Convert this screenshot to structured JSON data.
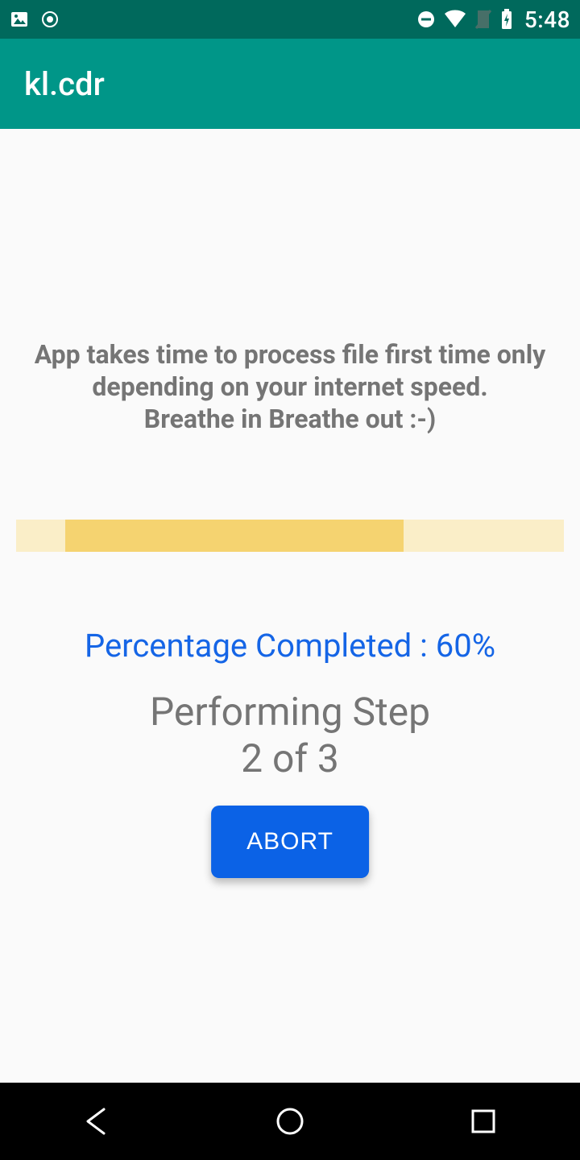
{
  "status_bar": {
    "time": "5:48",
    "icons": {
      "picture": "picture-icon",
      "circle": "circle-icon",
      "dnd": "dnd-icon",
      "wifi": "wifi-icon",
      "no_sim": "no-sim-icon",
      "battery": "battery-charging-icon"
    }
  },
  "app_bar": {
    "title": "kl.cdr"
  },
  "content": {
    "info_line1": "App takes time to process file first time only",
    "info_line2": "depending on your internet speed.",
    "info_line3": "Breathe in Breathe out :-)",
    "progress_percent_value": 60,
    "percent_label": "Percentage Completed : 60%",
    "step_line1": "Performing Step",
    "step_line2": "2 of 3",
    "abort_label": "ABORT"
  },
  "nav": {
    "back": "back",
    "home": "home",
    "recent": "recent"
  },
  "colors": {
    "status_bg": "#00695c",
    "app_bar_bg": "#009688",
    "accent_blue": "#0b62e6",
    "progress_track": "#faeec8",
    "progress_fill": "#f5d370",
    "text_muted": "#757575"
  }
}
